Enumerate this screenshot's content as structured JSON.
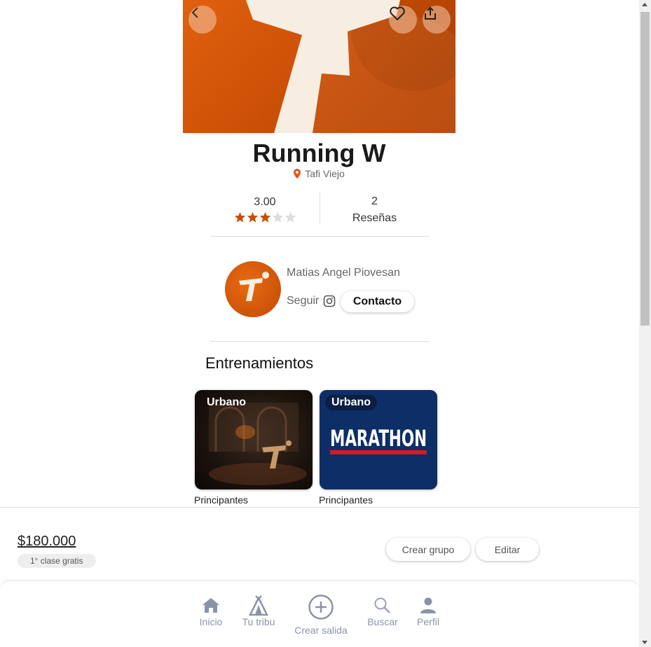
{
  "club": {
    "name": "Running W",
    "location": "Tafi Viejo",
    "rating_value": "3.00",
    "rating_stars": 3,
    "rating_max": 5,
    "reviews_count": "2",
    "reviews_label": "Reseñas"
  },
  "owner": {
    "name": "Matias Angel Piovesan",
    "follow_label": "Seguir",
    "contact_label": "Contacto"
  },
  "trainings": {
    "title": "Entrenamientos",
    "items": [
      {
        "badge": "Urbano",
        "level": "Principantes",
        "image_text": ""
      },
      {
        "badge": "Urbano",
        "level": "Principantes",
        "image_text": "MARATHON"
      }
    ]
  },
  "booking": {
    "price": "$180.000",
    "promo": "1° clase gratis",
    "create_group_label": "Crear grupo",
    "edit_label": "Editar"
  },
  "nav": {
    "items": [
      {
        "label": "Inicio",
        "icon": "home-icon"
      },
      {
        "label": "Tu tribu",
        "icon": "tent-icon"
      },
      {
        "label": "Crear salida",
        "icon": "plus-circle-icon"
      },
      {
        "label": "Buscar",
        "icon": "search-icon"
      },
      {
        "label": "Perfil",
        "icon": "user-icon"
      }
    ]
  },
  "colors": {
    "brand": "#d9580a",
    "star_filled": "#c6500b",
    "star_empty": "#dddddd",
    "nav_icon": "#8a93a6",
    "marathon_bg": "#0d2e66",
    "marathon_stripe": "#d71920"
  }
}
